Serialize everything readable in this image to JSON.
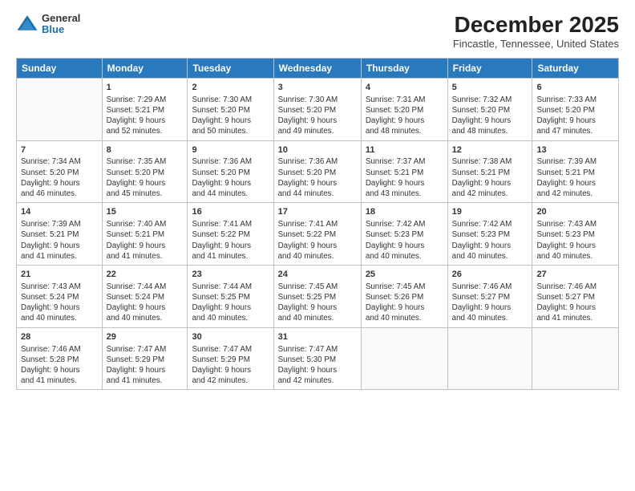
{
  "logo": {
    "general": "General",
    "blue": "Blue"
  },
  "header": {
    "title": "December 2025",
    "subtitle": "Fincastle, Tennessee, United States"
  },
  "days_of_week": [
    "Sunday",
    "Monday",
    "Tuesday",
    "Wednesday",
    "Thursday",
    "Friday",
    "Saturday"
  ],
  "weeks": [
    [
      {
        "day": "",
        "info": ""
      },
      {
        "day": "1",
        "info": "Sunrise: 7:29 AM\nSunset: 5:21 PM\nDaylight: 9 hours\nand 52 minutes."
      },
      {
        "day": "2",
        "info": "Sunrise: 7:30 AM\nSunset: 5:20 PM\nDaylight: 9 hours\nand 50 minutes."
      },
      {
        "day": "3",
        "info": "Sunrise: 7:30 AM\nSunset: 5:20 PM\nDaylight: 9 hours\nand 49 minutes."
      },
      {
        "day": "4",
        "info": "Sunrise: 7:31 AM\nSunset: 5:20 PM\nDaylight: 9 hours\nand 48 minutes."
      },
      {
        "day": "5",
        "info": "Sunrise: 7:32 AM\nSunset: 5:20 PM\nDaylight: 9 hours\nand 48 minutes."
      },
      {
        "day": "6",
        "info": "Sunrise: 7:33 AM\nSunset: 5:20 PM\nDaylight: 9 hours\nand 47 minutes."
      }
    ],
    [
      {
        "day": "7",
        "info": "Sunrise: 7:34 AM\nSunset: 5:20 PM\nDaylight: 9 hours\nand 46 minutes."
      },
      {
        "day": "8",
        "info": "Sunrise: 7:35 AM\nSunset: 5:20 PM\nDaylight: 9 hours\nand 45 minutes."
      },
      {
        "day": "9",
        "info": "Sunrise: 7:36 AM\nSunset: 5:20 PM\nDaylight: 9 hours\nand 44 minutes."
      },
      {
        "day": "10",
        "info": "Sunrise: 7:36 AM\nSunset: 5:20 PM\nDaylight: 9 hours\nand 44 minutes."
      },
      {
        "day": "11",
        "info": "Sunrise: 7:37 AM\nSunset: 5:21 PM\nDaylight: 9 hours\nand 43 minutes."
      },
      {
        "day": "12",
        "info": "Sunrise: 7:38 AM\nSunset: 5:21 PM\nDaylight: 9 hours\nand 42 minutes."
      },
      {
        "day": "13",
        "info": "Sunrise: 7:39 AM\nSunset: 5:21 PM\nDaylight: 9 hours\nand 42 minutes."
      }
    ],
    [
      {
        "day": "14",
        "info": "Sunrise: 7:39 AM\nSunset: 5:21 PM\nDaylight: 9 hours\nand 41 minutes."
      },
      {
        "day": "15",
        "info": "Sunrise: 7:40 AM\nSunset: 5:21 PM\nDaylight: 9 hours\nand 41 minutes."
      },
      {
        "day": "16",
        "info": "Sunrise: 7:41 AM\nSunset: 5:22 PM\nDaylight: 9 hours\nand 41 minutes."
      },
      {
        "day": "17",
        "info": "Sunrise: 7:41 AM\nSunset: 5:22 PM\nDaylight: 9 hours\nand 40 minutes."
      },
      {
        "day": "18",
        "info": "Sunrise: 7:42 AM\nSunset: 5:23 PM\nDaylight: 9 hours\nand 40 minutes."
      },
      {
        "day": "19",
        "info": "Sunrise: 7:42 AM\nSunset: 5:23 PM\nDaylight: 9 hours\nand 40 minutes."
      },
      {
        "day": "20",
        "info": "Sunrise: 7:43 AM\nSunset: 5:23 PM\nDaylight: 9 hours\nand 40 minutes."
      }
    ],
    [
      {
        "day": "21",
        "info": "Sunrise: 7:43 AM\nSunset: 5:24 PM\nDaylight: 9 hours\nand 40 minutes."
      },
      {
        "day": "22",
        "info": "Sunrise: 7:44 AM\nSunset: 5:24 PM\nDaylight: 9 hours\nand 40 minutes."
      },
      {
        "day": "23",
        "info": "Sunrise: 7:44 AM\nSunset: 5:25 PM\nDaylight: 9 hours\nand 40 minutes."
      },
      {
        "day": "24",
        "info": "Sunrise: 7:45 AM\nSunset: 5:25 PM\nDaylight: 9 hours\nand 40 minutes."
      },
      {
        "day": "25",
        "info": "Sunrise: 7:45 AM\nSunset: 5:26 PM\nDaylight: 9 hours\nand 40 minutes."
      },
      {
        "day": "26",
        "info": "Sunrise: 7:46 AM\nSunset: 5:27 PM\nDaylight: 9 hours\nand 40 minutes."
      },
      {
        "day": "27",
        "info": "Sunrise: 7:46 AM\nSunset: 5:27 PM\nDaylight: 9 hours\nand 41 minutes."
      }
    ],
    [
      {
        "day": "28",
        "info": "Sunrise: 7:46 AM\nSunset: 5:28 PM\nDaylight: 9 hours\nand 41 minutes."
      },
      {
        "day": "29",
        "info": "Sunrise: 7:47 AM\nSunset: 5:29 PM\nDaylight: 9 hours\nand 41 minutes."
      },
      {
        "day": "30",
        "info": "Sunrise: 7:47 AM\nSunset: 5:29 PM\nDaylight: 9 hours\nand 42 minutes."
      },
      {
        "day": "31",
        "info": "Sunrise: 7:47 AM\nSunset: 5:30 PM\nDaylight: 9 hours\nand 42 minutes."
      },
      {
        "day": "",
        "info": ""
      },
      {
        "day": "",
        "info": ""
      },
      {
        "day": "",
        "info": ""
      }
    ]
  ]
}
